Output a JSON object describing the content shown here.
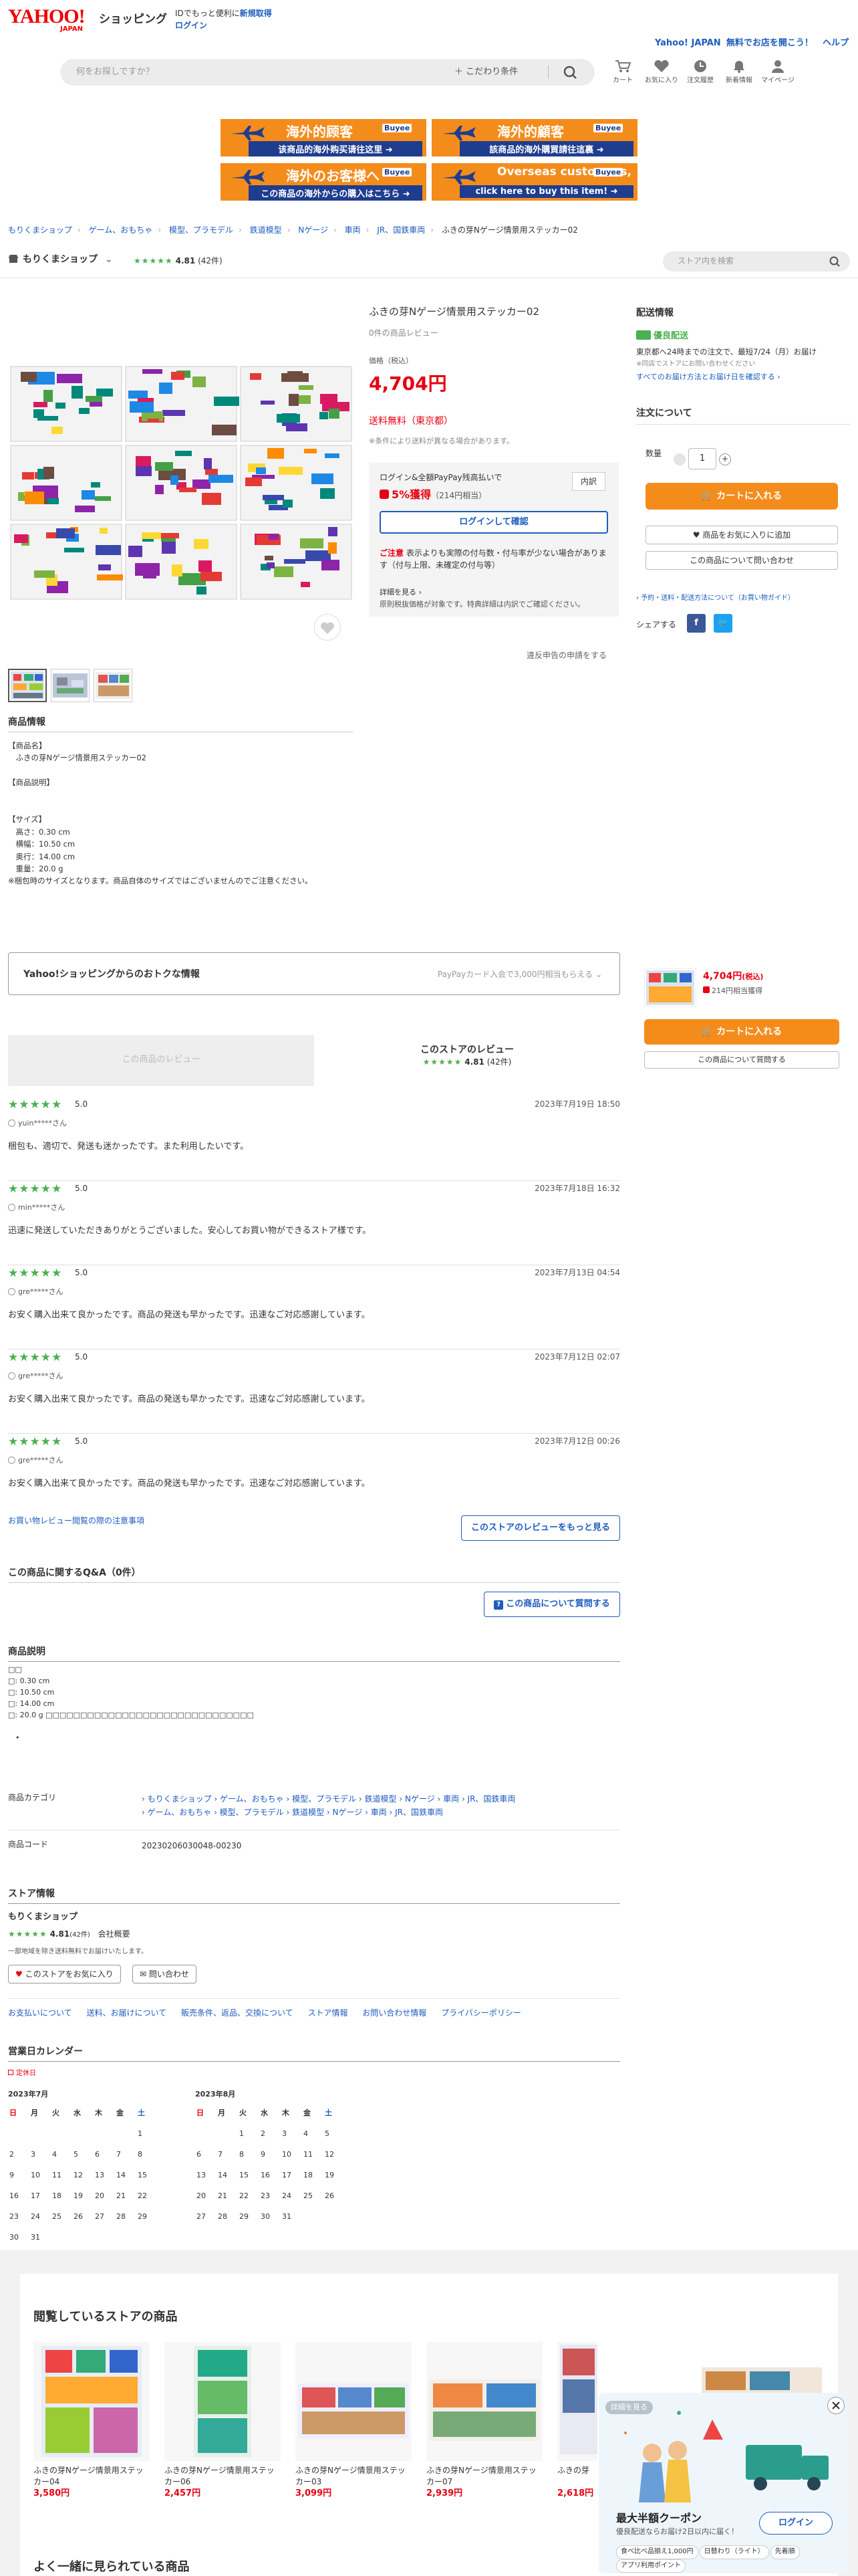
{
  "header": {
    "logo": "YAHOO!",
    "logo_sub": "JAPAN",
    "shopping": "ショッピング",
    "id_text": "IDでもっと便利に",
    "signup": "新規取得",
    "login": "ログイン",
    "promo_prefix": "Yahoo! JAPAN",
    "promo": "無料でお店を開こう！",
    "help": "ヘルプ",
    "search_placeholder": "何をお探しですか？",
    "filter": "こだわり条件",
    "nav": [
      "カート",
      "お気に入り",
      "注文履歴",
      "新着情報",
      "マイページ"
    ]
  },
  "banners": [
    {
      "title": "海外的顾客",
      "logo": "Buyee",
      "sub": "该商品的海外购买请往这里 ➜"
    },
    {
      "title": "海外的顧客",
      "logo": "Buyee",
      "sub": "該商品的海外購買請往這裏 ➜"
    },
    {
      "title": "海外のお客様へ",
      "logo": "Buyee",
      "sub": "この商品の海外からの購入はこちら ➜"
    },
    {
      "title": "Overseas customers,",
      "logo": "Buyee",
      "sub": "click here to buy this item! ➜"
    }
  ],
  "breadcrumb": [
    "もりくまショップ",
    "ゲーム、おもちゃ",
    "模型、プラモデル",
    "鉄道模型",
    "Nゲージ",
    "車両",
    "JR、国鉄車両",
    "ふきの芽Nゲージ情景用ステッカー02"
  ],
  "store": {
    "name": "もりくまショップ",
    "rating": "4.81",
    "count": "(42件)",
    "search_placeholder": "ストア内を検索"
  },
  "product": {
    "name": "ふきの芽Nゲージ情景用ステッカー02",
    "reviews": "0件の商品レビュー",
    "price_label": "価格（税込）",
    "price": "4,704円",
    "shipping": "送料無料（東京都）",
    "shipping_note": "※条件により送料が異なる場合があります。",
    "paypay_login": "ログイン&全額PayPay残高払いで",
    "paypay_pct": "5%獲得",
    "paypay_amount": "（214円相当）",
    "detail_btn": "内訳",
    "login_btn": "ログインして確認",
    "care_head": "ご注意",
    "care_text": "表示よりも実際の付与数・付与率が少ない場合があります（付与上限、未確定の付与等）",
    "more": "詳細を見る ›",
    "more2": "原則税抜価格が対象です。特典詳細は内訳でご確認ください。",
    "violate": "違反申告の申請をする"
  },
  "delivery": {
    "title": "配送情報",
    "fast": "優良配送",
    "date": "東京都へ24時までの注文で、最短7/24（月）お届け",
    "note": "※同店でストアにお問い合わせください",
    "link": "すべてのお届け方法とお届け日を確認する ›",
    "order_title": "注文について",
    "qty_label": "数量",
    "qty": "1",
    "cart": "カートに入れる",
    "fav": "商品をお気に入りに追加",
    "ask": "この商品について問い合わせ",
    "pay_link": "› 予約・送料・配送方法について（お買い物ガイド）",
    "share": "シェアする"
  },
  "product_info": {
    "title": "商品情報",
    "body": "【商品名】\n　ふきの芽Nゲージ情景用ステッカー02\n\n【商品説明】\n\n\n【サイズ】\n　高さ：0.30 cm\n　横幅：10.50 cm\n　奥行：14.00 cm\n　重量：20.0 g\n※梱包時のサイズとなります。商品自体のサイズではございませんのでご注意ください。"
  },
  "deals": {
    "title": "Yahoo!ショッピングからのおトクな情報",
    "right": "PayPayカード入会で3,000円相当もらえる ⌄"
  },
  "sticky": {
    "price": "4,704円",
    "tax": "(税込)",
    "points": "214円相当獲得",
    "cart": "カートに入れる",
    "ask": "この商品について質問する"
  },
  "review_tabs": {
    "product": "この商品のレビュー",
    "store": "このストアのレビュー",
    "rating": "4.81",
    "count": "(42件)"
  },
  "reviews": [
    {
      "score": "5.0",
      "date": "2023年7月19日 18:50",
      "user": "yuin*****さん",
      "body": "梱包も、適切で、発送も迷かったです。また利用したいです。"
    },
    {
      "score": "5.0",
      "date": "2023年7月18日 16:32",
      "user": "min*****さん",
      "body": "迅速に発送していただきありがとうございました。安心してお買い物ができるストア様です。"
    },
    {
      "score": "5.0",
      "date": "2023年7月13日 04:54",
      "user": "gre*****さん",
      "body": "お安く購入出来て良かったです。商品の発送も早かったです。迅速なご対応感謝しています。"
    },
    {
      "score": "5.0",
      "date": "2023年7月12日 02:07",
      "user": "gre*****さん",
      "body": "お安く購入出来て良かったです。商品の発送も早かったです。迅速なご対応感謝しています。"
    },
    {
      "score": "5.0",
      "date": "2023年7月12日 00:26",
      "user": "gre*****さん",
      "body": "お安く購入出来て良かったです。商品の発送も早かったです。迅速なご対応感謝しています。"
    }
  ],
  "review_footer": {
    "note_link": "お買い物レビュー閲覧の際の注意事項",
    "more_btn": "このストアのレビューをもっと見る"
  },
  "qa": {
    "title": "この商品に関するQ&A（0件）",
    "btn": "この商品について質問する"
  },
  "description": {
    "title": "商品説明",
    "body": "□□\n□: 0.30 cm\n□: 10.50 cm\n□: 14.00 cm\n□: 20.0 g □□□□□□□□□□□□□□□□□□□□□□□□□□□□□□\n\n　•"
  },
  "specs": {
    "cat_label": "商品カテゴリ",
    "cat1": "› もりくまショップ › ゲーム、おもちゃ › 模型、プラモデル › 鉄道模型 › Nゲージ › 車両 › JR、国鉄車両",
    "cat2": "› ゲーム、おもちゃ › 模型、プラモデル › 鉄道模型 › Nゲージ › 車両 › JR、国鉄車両",
    "code_label": "商品コード",
    "code": "20230206030048-00230"
  },
  "store_info": {
    "title": "ストア情報",
    "name": "もりくまショップ",
    "rating": "4.81",
    "count": "(42件)",
    "overview": "会社概要",
    "note": "一部地域を除き送料無料でお届けいたします。",
    "fav_btn": "このストアをお気に入り",
    "contact_btn": "問い合わせ",
    "links": [
      "お支払いについて",
      "送料、お届けについて",
      "販売条件、返品、交換について",
      "ストア情報",
      "お問い合わせ情報",
      "プライバシーポリシー"
    ]
  },
  "calendar": {
    "title": "営業日カレンダー",
    "legend": "定休日",
    "weekdays": [
      "日",
      "月",
      "火",
      "水",
      "木",
      "金",
      "土"
    ],
    "months": [
      {
        "name": "2023年7月",
        "days": [
          "",
          "",
          "",
          "",
          "",
          "",
          "1",
          "2",
          "3",
          "4",
          "5",
          "6",
          "7",
          "8",
          "9",
          "10",
          "11",
          "12",
          "13",
          "14",
          "15",
          "16",
          "17",
          "18",
          "19",
          "20",
          "21",
          "22",
          "23",
          "24",
          "25",
          "26",
          "27",
          "28",
          "29",
          "30",
          "31"
        ]
      },
      {
        "name": "2023年8月",
        "days": [
          "",
          "",
          "1",
          "2",
          "3",
          "4",
          "5",
          "6",
          "7",
          "8",
          "9",
          "10",
          "11",
          "12",
          "13",
          "14",
          "15",
          "16",
          "17",
          "18",
          "19",
          "20",
          "21",
          "22",
          "23",
          "24",
          "25",
          "26",
          "27",
          "28",
          "29",
          "30",
          "31"
        ]
      }
    ]
  },
  "browsed": {
    "title": "閲覧しているストアの商品",
    "items": [
      {
        "name": "ふきの芽Nゲージ情景用ステッカー04",
        "price": "3,580円"
      },
      {
        "name": "ふきの芽Nゲージ情景用ステッカー06",
        "price": "2,457円"
      },
      {
        "name": "ふきの芽Nゲージ情景用ステッカー03",
        "price": "3,099円"
      },
      {
        "name": "ふきの芽Nゲージ情景用ステッカー07",
        "price": "2,939円"
      },
      {
        "name": "ふきの芽",
        "price": "2,618円"
      }
    ],
    "title2": "よく一緒に見られている商品"
  },
  "popup": {
    "tag": "詳細を見る",
    "title": "最大半額クーポン",
    "sub": "優良配送ならお届け2日以内に届く！",
    "login": "ログイン",
    "chips": [
      "食べ比べ品揃え1,000円",
      "日替わり（ライト）",
      "先着順",
      "アプリ利用ポイント"
    ]
  },
  "colors": {
    "accent": "#e60012",
    "orange": "#f48c1c",
    "link": "#1e5cbe",
    "star": "#4caf50"
  }
}
